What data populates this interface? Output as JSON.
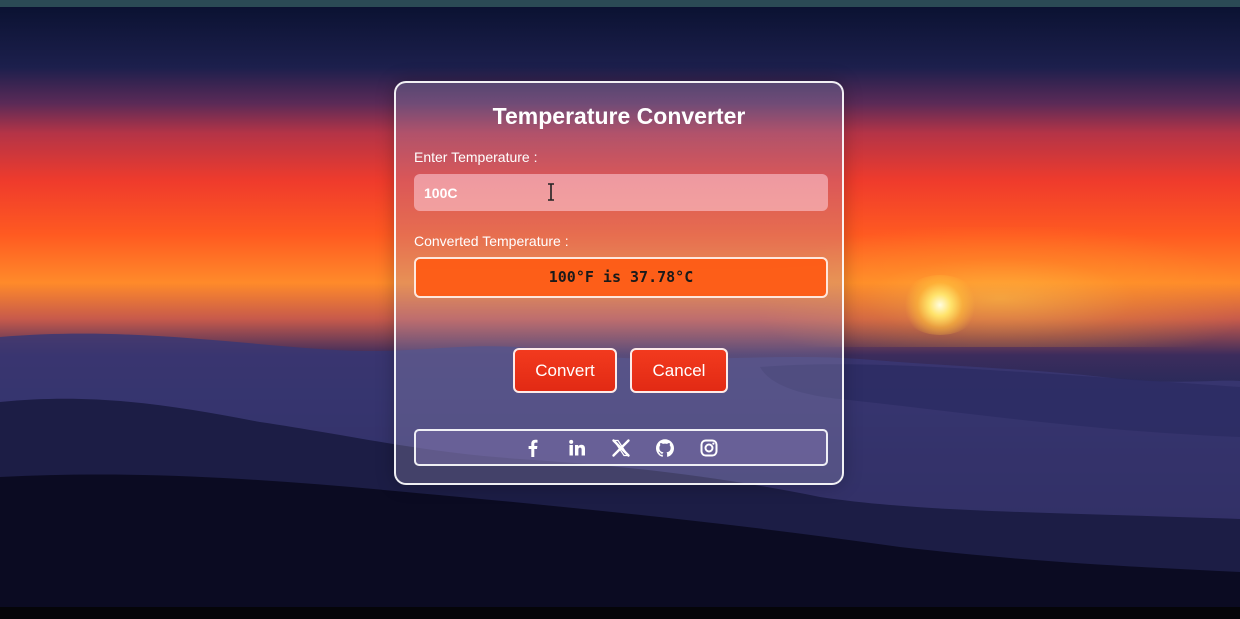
{
  "converter": {
    "title": "Temperature Converter",
    "input_label": "Enter Temperature :",
    "input_value": "100C",
    "output_label": "Converted Temperature :",
    "output_value": "100°F is 37.78°C",
    "convert_label": "Convert",
    "cancel_label": "Cancel"
  },
  "social": {
    "icons": [
      "facebook-icon",
      "linkedin-icon",
      "x-icon",
      "github-icon",
      "instagram-icon"
    ]
  },
  "colors": {
    "button": "#e8301a",
    "result_bg": "#ff5a14",
    "card_border": "#ffffff"
  }
}
